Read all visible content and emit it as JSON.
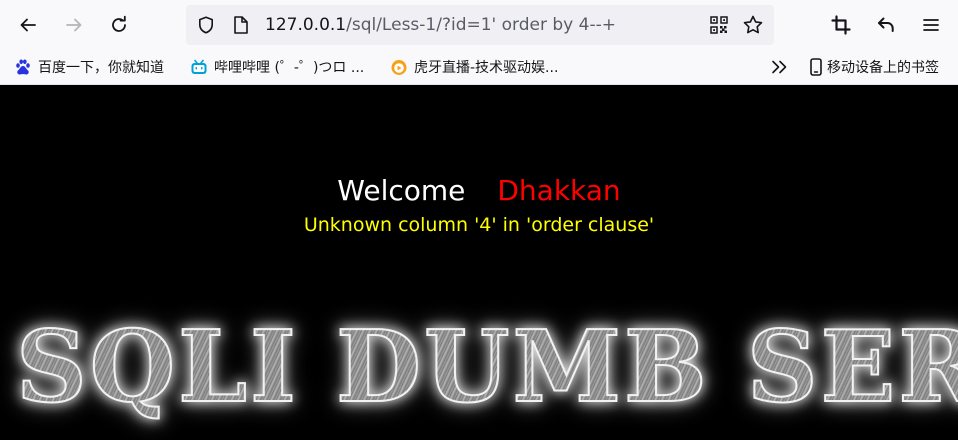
{
  "browser": {
    "url_host": "127.0.0.1",
    "url_path": "/sql/Less-1/?id=1' order by 4--+",
    "bookmarks": [
      {
        "label": "百度一下，你就知道",
        "icon": "baidu-icon"
      },
      {
        "label": "哔哩哔哩 (゜-゜)つロ ...",
        "icon": "bilibili-icon"
      },
      {
        "label": "虎牙直播-技术驱动娱...",
        "icon": "huya-icon"
      }
    ],
    "mobile_bookmarks_label": "移动设备上的书签"
  },
  "page": {
    "welcome": "Welcome",
    "name": "Dhakkan",
    "error": "Unknown column '4' in 'order clause'",
    "banner": "SQLI DUMB SERIES"
  }
}
